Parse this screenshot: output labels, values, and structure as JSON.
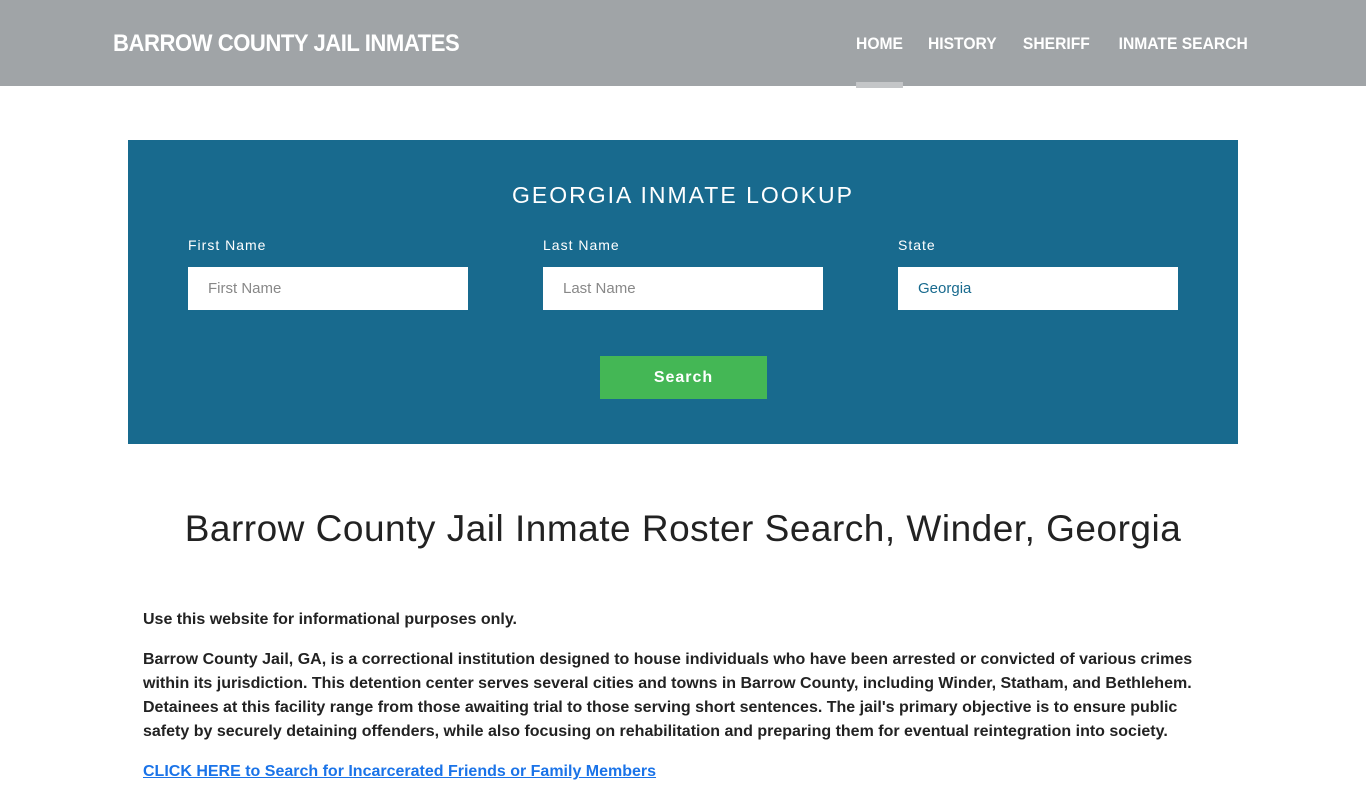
{
  "header": {
    "brand": "BARROW COUNTY JAIL INMATES",
    "menu": [
      "HOME",
      "HISTORY",
      "SHERIFF",
      "INMATE SEARCH"
    ]
  },
  "lookup": {
    "title": "GEORGIA INMATE LOOKUP",
    "first_label": "First Name",
    "first_placeholder": "First Name",
    "last_label": "Last Name",
    "last_placeholder": "Last Name",
    "state_label": "State",
    "state_value": "Georgia",
    "search": "Search"
  },
  "main": {
    "title": "Barrow County Jail Inmate Roster Search, Winder, Georgia",
    "p1": "Use this website for informational purposes only.",
    "p2": "Barrow County Jail, GA, is a correctional institution designed to house individuals who have been arrested or convicted of various crimes within its jurisdiction. This detention center serves several cities and towns in Barrow County, including Winder, Statham, and Bethlehem. Detainees at this facility range from those awaiting trial to those serving short sentences. The jail's primary objective is to ensure public safety by securely detaining offenders, while also focusing on rehabilitation and preparing them for eventual reintegration into society.",
    "link": "CLICK HERE to Search for Incarcerated Friends or Family Members"
  }
}
